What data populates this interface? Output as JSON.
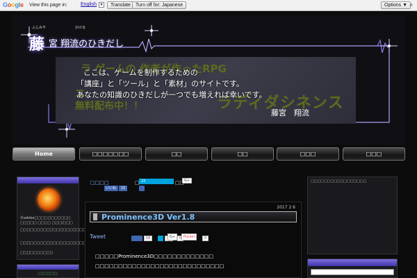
{
  "translate_bar": {
    "logo": "Google",
    "view_text": "View this page in:",
    "language": "English",
    "translate_label": "Translate",
    "turn_off_label": "Turn off for: Japanese",
    "options_label": "Options ▼",
    "close_symbol": "×"
  },
  "header": {
    "title_kanji": "藤",
    "title_rest": "宮 翔流のひきだし",
    "ruby_1": "ふじみや",
    "ruby_2": "かける",
    "bg_text_1": "ラ ゲームの 作者が作ったRPG",
    "bg_text_2": "キ",
    "bg_text_3": "無料配布中！！",
    "bg_text_4": "ラディダシネンス",
    "bg_text_5": "エ",
    "lines": [
      "ここは、ゲームを制作するための",
      "「講座」と「ツール」と「素材」のサイトです。",
      "あなたの知識のひきだしが一つでも増えれば幸いです。"
    ],
    "signature": "藤宮　翔流"
  },
  "nav": [
    "Home",
    "□□□□□□□",
    "□□",
    "□□",
    "□□□",
    "□□□"
  ],
  "left_sidebar": {
    "line_1": "Ⓡadobe□□□□□□□□□□□",
    "line_2": "□□□□□ □□□□ □□□/□□□",
    "line_3": "□□□□□□□□□□□□□□□□□□□□□□□□",
    "line_4": "□□□□□□□□□□□□□□□□□□□□□□",
    "line_5": "□□□□□□□□□□",
    "bottom_text": "□□□□□"
  },
  "right_sidebar": {
    "title": "□□□□□□□□□□□□□□□□□"
  },
  "social_top": {
    "label_1": "□□□□",
    "like_label": "いいね",
    "like_count": "10",
    "bracket": "□",
    "hatena_count": "23",
    "label_2": "□□",
    "gplus_label": "G+"
  },
  "article": {
    "date": "2017 2 6",
    "title": "Prominence3D Ver1.8",
    "tweet_label": "Tweet",
    "like_count": "10",
    "hatena_count": "23",
    "gplus_label": "G+",
    "gplus_count": "0",
    "pocket_label": "Pocket",
    "pocket_count": "0",
    "body_1": "□□□□□Prominence3D□□□□□□□□□□□□□",
    "body_2": "□□□□□□□□□□□□□□□□□□□□□□□□□□□□"
  },
  "colors": {
    "accent_purple": "#7c6bff",
    "link_blue": "#8ab4ff",
    "title_blue": "#7ec3ff",
    "facebook_blue": "#4267b2",
    "hatena_blue": "#00a4de",
    "gplus_red": "#dd4b39",
    "pocket_red": "#ee4056"
  }
}
